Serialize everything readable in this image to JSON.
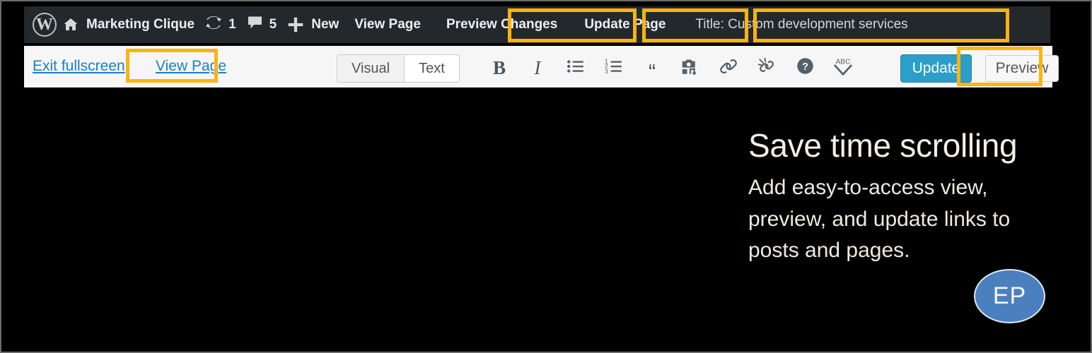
{
  "admin_bar": {
    "logo_icon": "wordpress-logo-icon",
    "home_icon": "home-icon",
    "site_name": "Marketing Clique",
    "updates": {
      "icon": "updates-refresh-icon",
      "count": "1"
    },
    "comments": {
      "icon": "comment-bubble-icon",
      "count": "5"
    },
    "new_item": {
      "icon": "plus-icon",
      "label": "New"
    },
    "view_page": "View Page",
    "preview_changes": "Preview Changes",
    "update_page": "Update Page",
    "title_item": "Title: Custom development services"
  },
  "editor_bar": {
    "exit_fullscreen": "Exit fullscreen",
    "view_page": "View Page",
    "tabs": [
      {
        "label": "Visual",
        "active": true
      },
      {
        "label": "Text",
        "active": false
      }
    ],
    "tools": [
      {
        "name": "bold-icon",
        "glyph": "B"
      },
      {
        "name": "italic-icon",
        "glyph": "I"
      },
      {
        "name": "bulleted-list-icon",
        "glyph": "☰"
      },
      {
        "name": "numbered-list-icon",
        "glyph": "☰"
      },
      {
        "name": "blockquote-icon",
        "glyph": "“"
      },
      {
        "name": "add-media-icon",
        "glyph": "὏7"
      },
      {
        "name": "insert-link-icon",
        "glyph": "🔗"
      },
      {
        "name": "remove-link-icon",
        "glyph": "✂"
      },
      {
        "name": "help-icon",
        "glyph": "?"
      },
      {
        "name": "spellcheck-abc-icon",
        "glyph": "ABC"
      }
    ],
    "update_button": "Update",
    "preview_button": "Preview"
  },
  "promo": {
    "title": "Save time scrolling",
    "body": "Add easy-to-access view, preview, and update links to posts and pages.",
    "avatar_initials": "EP"
  },
  "colors": {
    "highlight": "#ffb30f",
    "admin_bar_bg": "#23282d",
    "toolbar_bg": "#f6f6f6",
    "link_blue": "#1b7fc4",
    "update_blue": "#2b9fc9",
    "avatar_blue": "#4a80c0",
    "canvas_black": "#000000"
  },
  "highlight_boxes": [
    {
      "name": "highlight-preview-changes"
    },
    {
      "name": "highlight-update-page"
    },
    {
      "name": "highlight-title-item"
    },
    {
      "name": "highlight-view-page-link"
    },
    {
      "name": "highlight-preview-button"
    }
  ]
}
